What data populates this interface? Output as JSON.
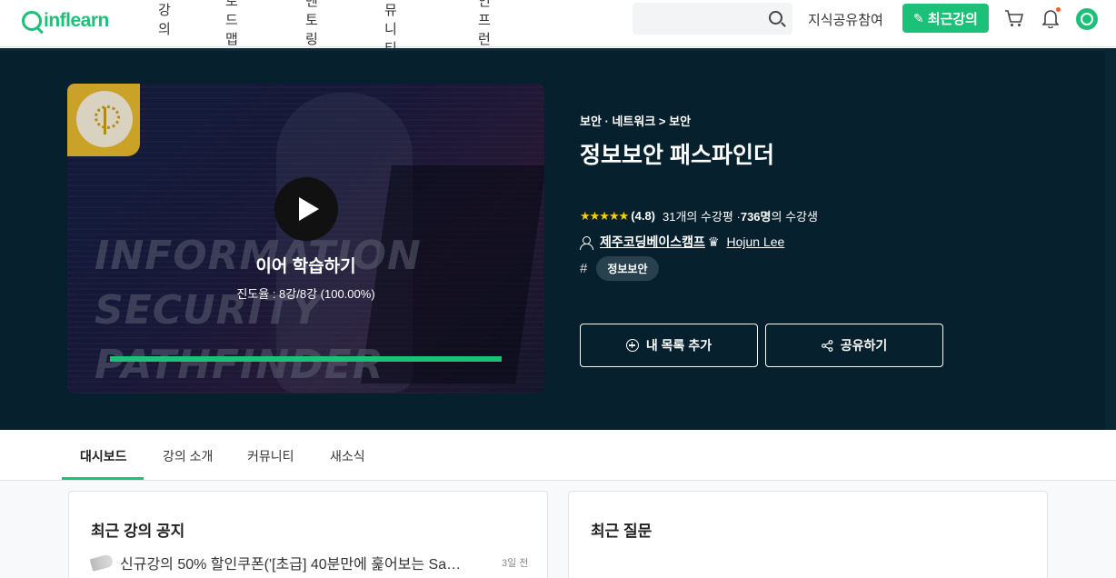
{
  "header": {
    "logo_text": "inflearn",
    "nav": [
      "강의",
      "로드맵",
      "멘토링",
      "커뮤니티",
      "인프런"
    ],
    "search_placeholder": "",
    "share_knowledge": "지식공유참여",
    "recent_course_button": "최근강의",
    "accent_color": "#1dc078"
  },
  "hero": {
    "thumbnail": {
      "title_art": "INFORMATION\nSECURITY\nPATHFINDER",
      "resume_label": "이어 학습하기",
      "progress_text": "진도율 : 8강/8강 (100.00%)",
      "progress_percent": 100
    },
    "breadcrumb": "보안 · 네트워크 > 보안",
    "title": "정보보안 패스파인더",
    "stars": "★★★★★",
    "rating": "(4.8)",
    "reviews_text": "31개의 수강평 · ",
    "students_count": "736명",
    "students_suffix": "의 수강생",
    "instructor_primary": "제주코딩베이스캠프",
    "instructor_secondary": "Hojun Lee",
    "tag": "정보보안",
    "add_list_button": "내 목록 추가",
    "share_button": "공유하기"
  },
  "tabs": [
    "대시보드",
    "강의 소개",
    "커뮤니티",
    "새소식"
  ],
  "cards": {
    "notice_title": "최근 강의 공지",
    "notice_item": "신규강의 50% 할인쿠폰('[초급] 40분만에 훑어보는 Sa…",
    "notice_time": "3일 전",
    "questions_title": "최근 질문"
  }
}
